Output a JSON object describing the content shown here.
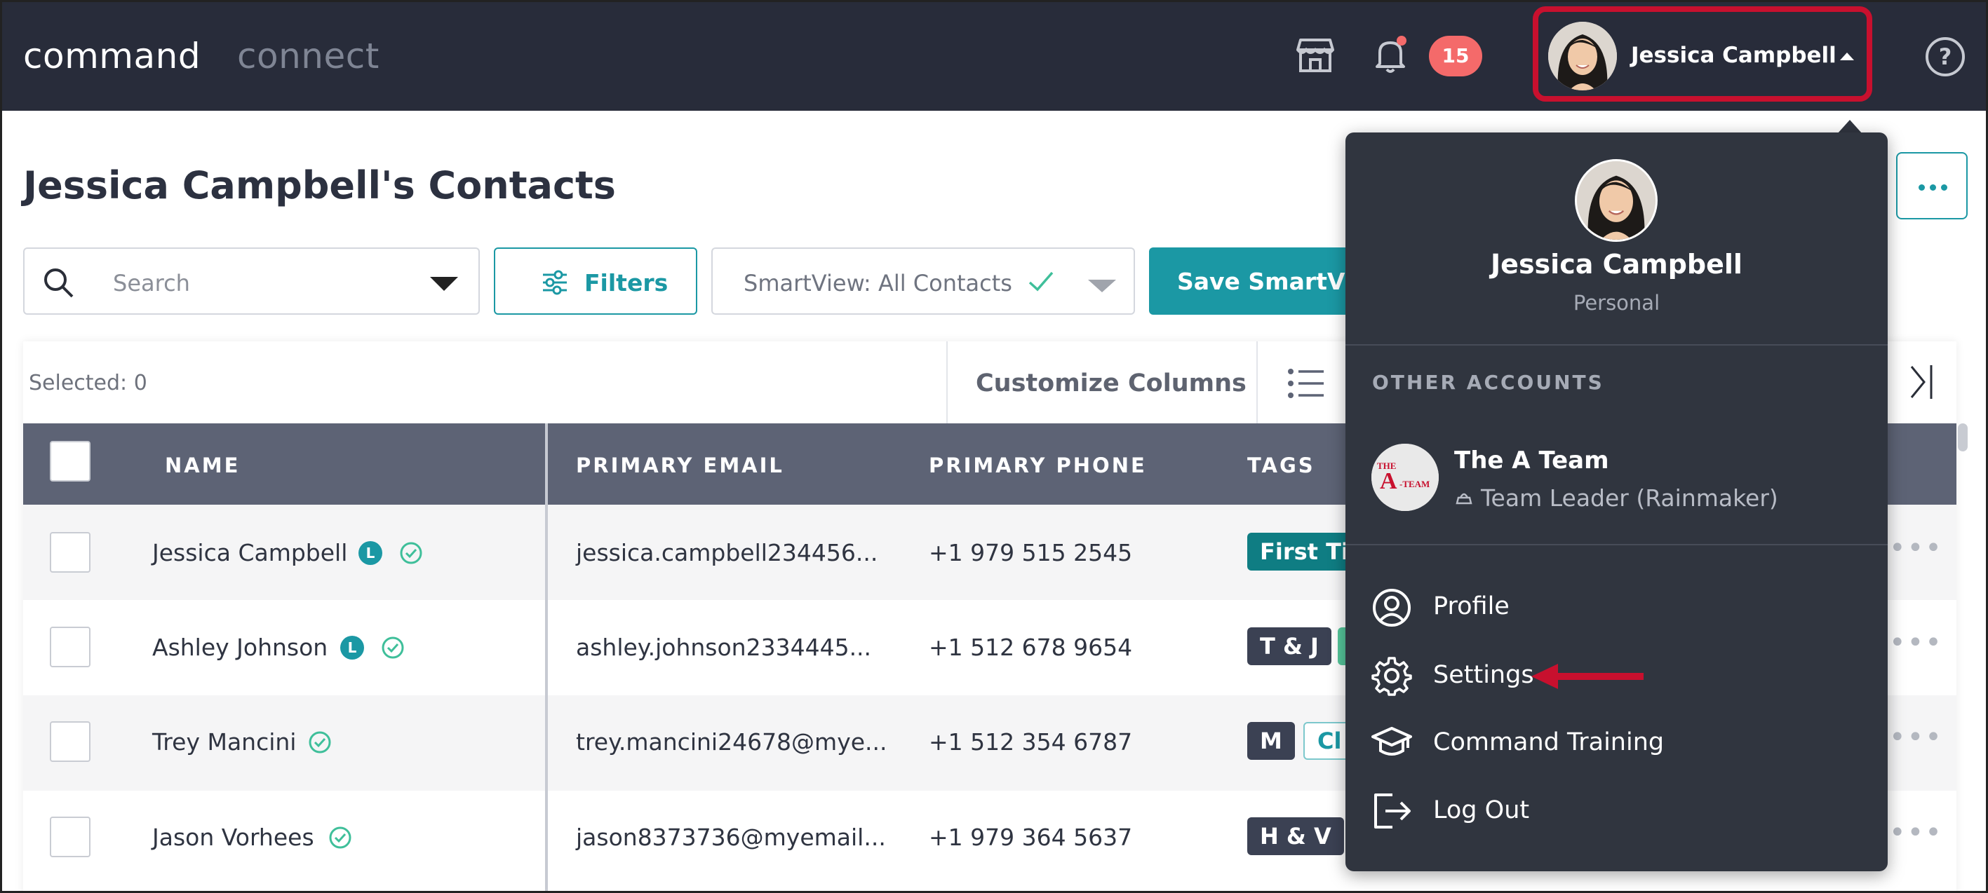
{
  "brand": {
    "primary": "command",
    "secondary": "connect"
  },
  "topbar": {
    "notifications_count": "15",
    "user_name": "Jessica Campbell",
    "help_label": "?"
  },
  "page": {
    "title": "Jessica Campbell's Contacts"
  },
  "toolbar": {
    "search_placeholder": "Search",
    "filters_label": "Filters",
    "smartview_label": "SmartView: All Contacts",
    "save_smartview_label": "Save SmartView"
  },
  "table": {
    "selected_label": "Selected: 0",
    "customize_label": "Customize Columns",
    "headers": {
      "name": "NAME",
      "email": "PRIMARY EMAIL",
      "phone": "PRIMARY PHONE",
      "tags": "TAGS"
    },
    "rows": [
      {
        "name": "Jessica Campbell",
        "lead_badge": "L",
        "email": "jessica.campbell234456...",
        "phone": "+1 979 515 2545",
        "tags": [
          "First Time"
        ]
      },
      {
        "name": "Ashley Johnson",
        "lead_badge": "L",
        "email": "ashley.johnson2334445...",
        "phone": "+1 512 678 9654",
        "tags": [
          "T & J",
          ""
        ]
      },
      {
        "name": "Trey Mancini",
        "email": "trey.mancini24678@mye...",
        "phone": "+1 512 354 6787",
        "tags": [
          "M",
          "Cl"
        ]
      },
      {
        "name": "Jason Vorhees",
        "email": "jason8373736@myemail...",
        "phone": "+1 979 364 5637",
        "tags": [
          "H & V"
        ]
      }
    ]
  },
  "dropdown": {
    "name": "Jessica Campbell",
    "account_type": "Personal",
    "other_accounts_label": "OTHER ACCOUNTS",
    "team": {
      "name": "The A Team",
      "role": "Team Leader (Rainmaker)",
      "logo_text": "THE A-TEAM"
    },
    "items": {
      "profile": "Profile",
      "settings": "Settings",
      "training": "Command Training",
      "logout": "Log Out"
    }
  },
  "colors": {
    "topbar": "#282c3a",
    "accent": "#1b98a4",
    "highlight": "#c8102e",
    "badge": "#f46a6a"
  }
}
